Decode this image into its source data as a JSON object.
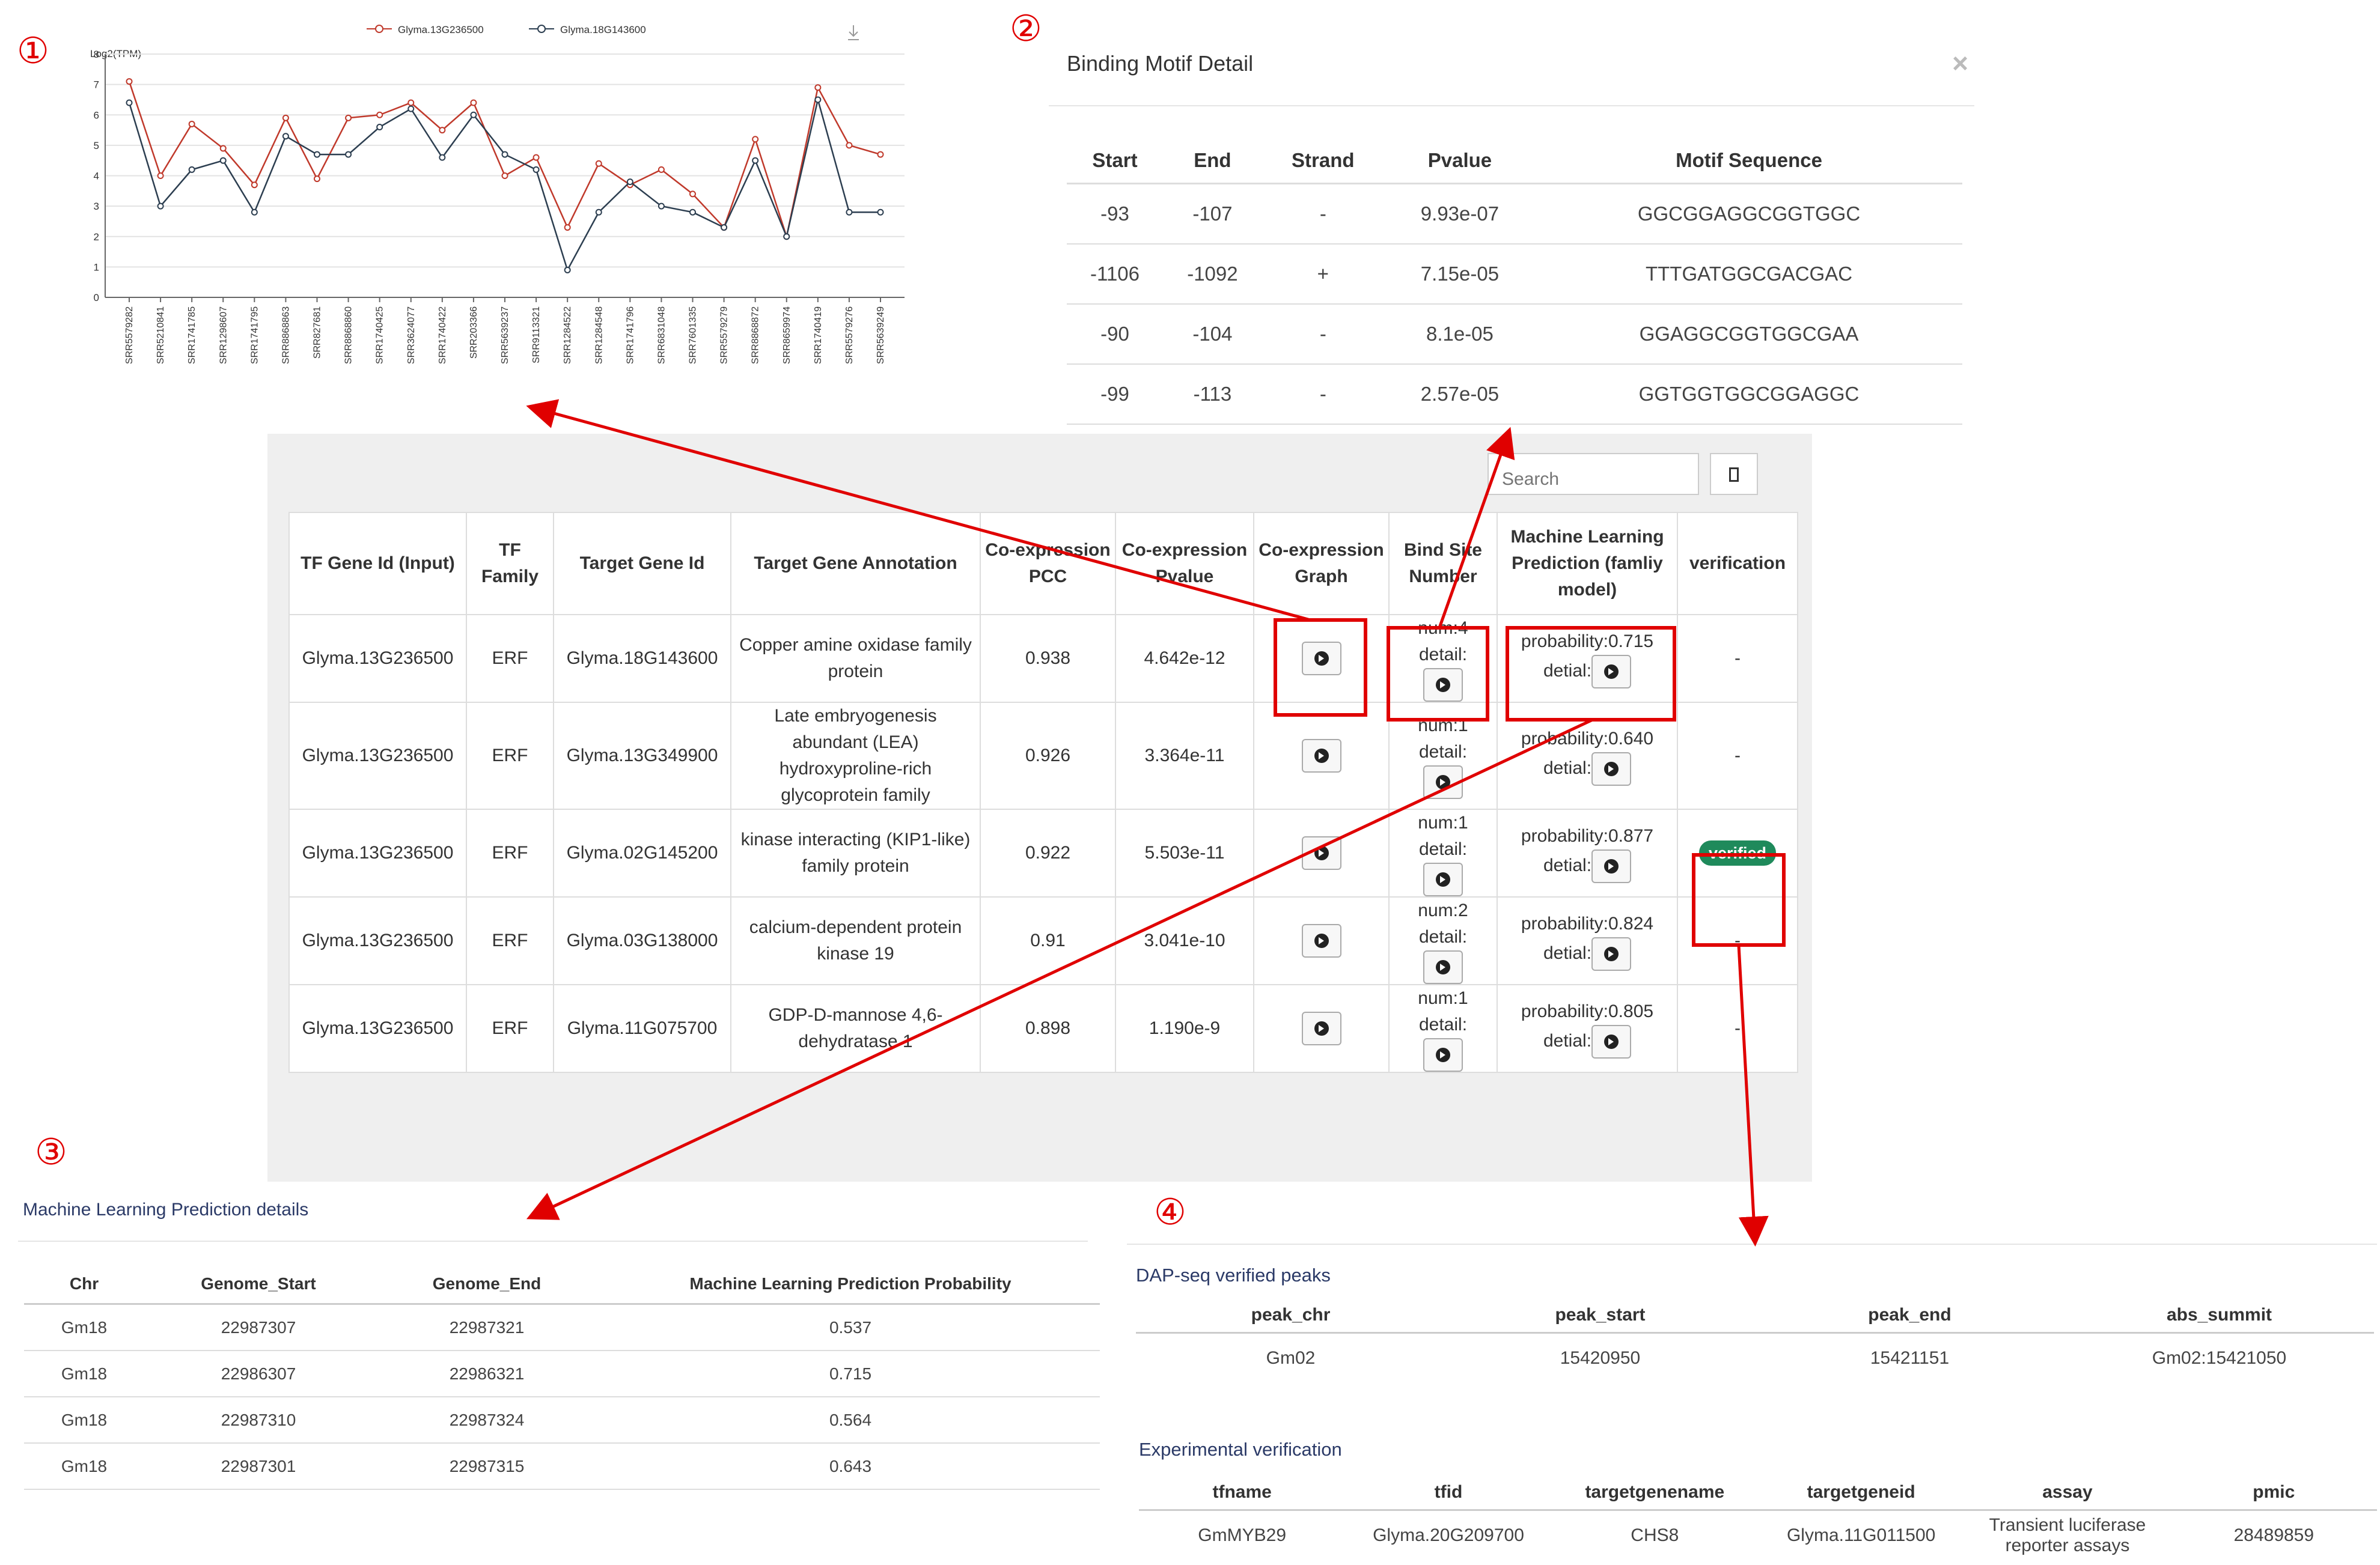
{
  "markers": {
    "m1": "①",
    "m2": "②",
    "m3": "③",
    "m4": "④"
  },
  "chart_data": {
    "type": "line",
    "title": "",
    "ylabel": "Log2(TPM)",
    "ylim": [
      0,
      8
    ],
    "yticks": [
      0,
      1,
      2,
      3,
      4,
      5,
      6,
      7,
      8
    ],
    "categories": [
      "SRR5579282",
      "SRR5210841",
      "SRR1741785",
      "SRR1298607",
      "SRR1741795",
      "SRR8868863",
      "SRR827681",
      "SRR8868860",
      "SRR1740425",
      "SRR3624077",
      "SRR1740422",
      "SRR203366",
      "SRR5639237",
      "SRR9113321",
      "SRR1284522",
      "SRR1284548",
      "SRR1741796",
      "SRR6831048",
      "SRR7601335",
      "SRR5579279",
      "SRR8868872",
      "SRR8659974",
      "SRR1740419",
      "SRR5579276",
      "SRR5639249"
    ],
    "series": [
      {
        "name": "Glyma.13G236500",
        "color": "#c0392b",
        "values": [
          7.1,
          4.0,
          5.7,
          4.9,
          3.7,
          5.9,
          3.9,
          5.9,
          6.0,
          6.4,
          5.5,
          6.4,
          4.0,
          4.6,
          2.3,
          4.4,
          3.7,
          4.2,
          3.4,
          2.3,
          5.2,
          2.0,
          6.9,
          5.0,
          4.7
        ]
      },
      {
        "name": "Glyma.18G143600",
        "color": "#2c3e50",
        "values": [
          6.4,
          3.0,
          4.2,
          4.5,
          2.8,
          5.3,
          4.7,
          4.7,
          5.6,
          6.2,
          4.6,
          6.0,
          4.7,
          4.2,
          0.9,
          2.8,
          3.8,
          3.0,
          2.8,
          2.3,
          4.5,
          2.0,
          6.5,
          2.8,
          2.8
        ]
      }
    ]
  },
  "motif": {
    "title": "Binding Motif Detail",
    "close": "×",
    "headers": [
      "Start",
      "End",
      "Strand",
      "Pvalue",
      "Motif Sequence"
    ],
    "rows": [
      [
        "-93",
        "-107",
        "-",
        "9.93e-07",
        "GGCGGAGGCGGTGGC"
      ],
      [
        "-1106",
        "-1092",
        "+",
        "7.15e-05",
        "TTTGATGGCGACGAC"
      ],
      [
        "-90",
        "-104",
        "-",
        "8.1e-05",
        "GGAGGCGGTGGCGAA"
      ],
      [
        "-99",
        "-113",
        "-",
        "2.57e-05",
        "GGTGGTGGCGGAGGC"
      ]
    ]
  },
  "main": {
    "search_placeholder": "Search",
    "headers": [
      "TF Gene Id (Input)",
      "TF Family",
      "Target Gene Id",
      "Target Gene Annotation",
      "Co-expression PCC",
      "Co-expression Pvalue",
      "Co-expression Graph",
      "Bind Site Number",
      "Machine Learning Prediction (famliy model)",
      "verification"
    ],
    "num_prefix": "num:",
    "detail_label": "detail:",
    "prob_prefix": "probability:",
    "detial_label": "detial:",
    "verified_label": "verified",
    "rows": [
      {
        "tf": "Glyma.13G236500",
        "family": "ERF",
        "target": "Glyma.18G143600",
        "annotation": "Copper amine oxidase family protein",
        "pcc": "0.938",
        "pvalue": "4.642e-12",
        "num": "4",
        "prob": "0.715",
        "verification": "-"
      },
      {
        "tf": "Glyma.13G236500",
        "family": "ERF",
        "target": "Glyma.13G349900",
        "annotation": "Late embryogenesis abundant (LEA) hydroxyproline-rich glycoprotein family",
        "pcc": "0.926",
        "pvalue": "3.364e-11",
        "num": "1",
        "prob": "0.640",
        "verification": "-"
      },
      {
        "tf": "Glyma.13G236500",
        "family": "ERF",
        "target": "Glyma.02G145200",
        "annotation": "kinase interacting (KIP1-like) family protein",
        "pcc": "0.922",
        "pvalue": "5.503e-11",
        "num": "1",
        "prob": "0.877",
        "verification": "verified"
      },
      {
        "tf": "Glyma.13G236500",
        "family": "ERF",
        "target": "Glyma.03G138000",
        "annotation": "calcium-dependent protein kinase 19",
        "pcc": "0.91",
        "pvalue": "3.041e-10",
        "num": "2",
        "prob": "0.824",
        "verification": "-"
      },
      {
        "tf": "Glyma.13G236500",
        "family": "ERF",
        "target": "Glyma.11G075700",
        "annotation": "GDP-D-mannose 4,6-dehydratase 1",
        "pcc": "0.898",
        "pvalue": "1.190e-9",
        "num": "1",
        "prob": "0.805",
        "verification": "-"
      }
    ]
  },
  "ml": {
    "title": "Machine Learning Prediction details",
    "headers": [
      "Chr",
      "Genome_Start",
      "Genome_End",
      "Machine Learning Prediction Probability"
    ],
    "rows": [
      [
        "Gm18",
        "22987307",
        "22987321",
        "0.537"
      ],
      [
        "Gm18",
        "22986307",
        "22986321",
        "0.715"
      ],
      [
        "Gm18",
        "22987310",
        "22987324",
        "0.564"
      ],
      [
        "Gm18",
        "22987301",
        "22987315",
        "0.643"
      ]
    ]
  },
  "dap": {
    "title": "DAP-seq verified peaks",
    "headers": [
      "peak_chr",
      "peak_start",
      "peak_end",
      "abs_summit"
    ],
    "rows": [
      [
        "Gm02",
        "15420950",
        "15421151",
        "Gm02:15421050"
      ]
    ]
  },
  "exp": {
    "title": "Experimental verification",
    "headers": [
      "tfname",
      "tfid",
      "targetgenename",
      "targetgeneid",
      "assay",
      "pmic"
    ],
    "rows": [
      [
        "GmMYB29",
        "Glyma.20G209700",
        "CHS8",
        "Glyma.11G011500",
        "Transient luciferase reporter assays",
        "28489859"
      ]
    ]
  }
}
